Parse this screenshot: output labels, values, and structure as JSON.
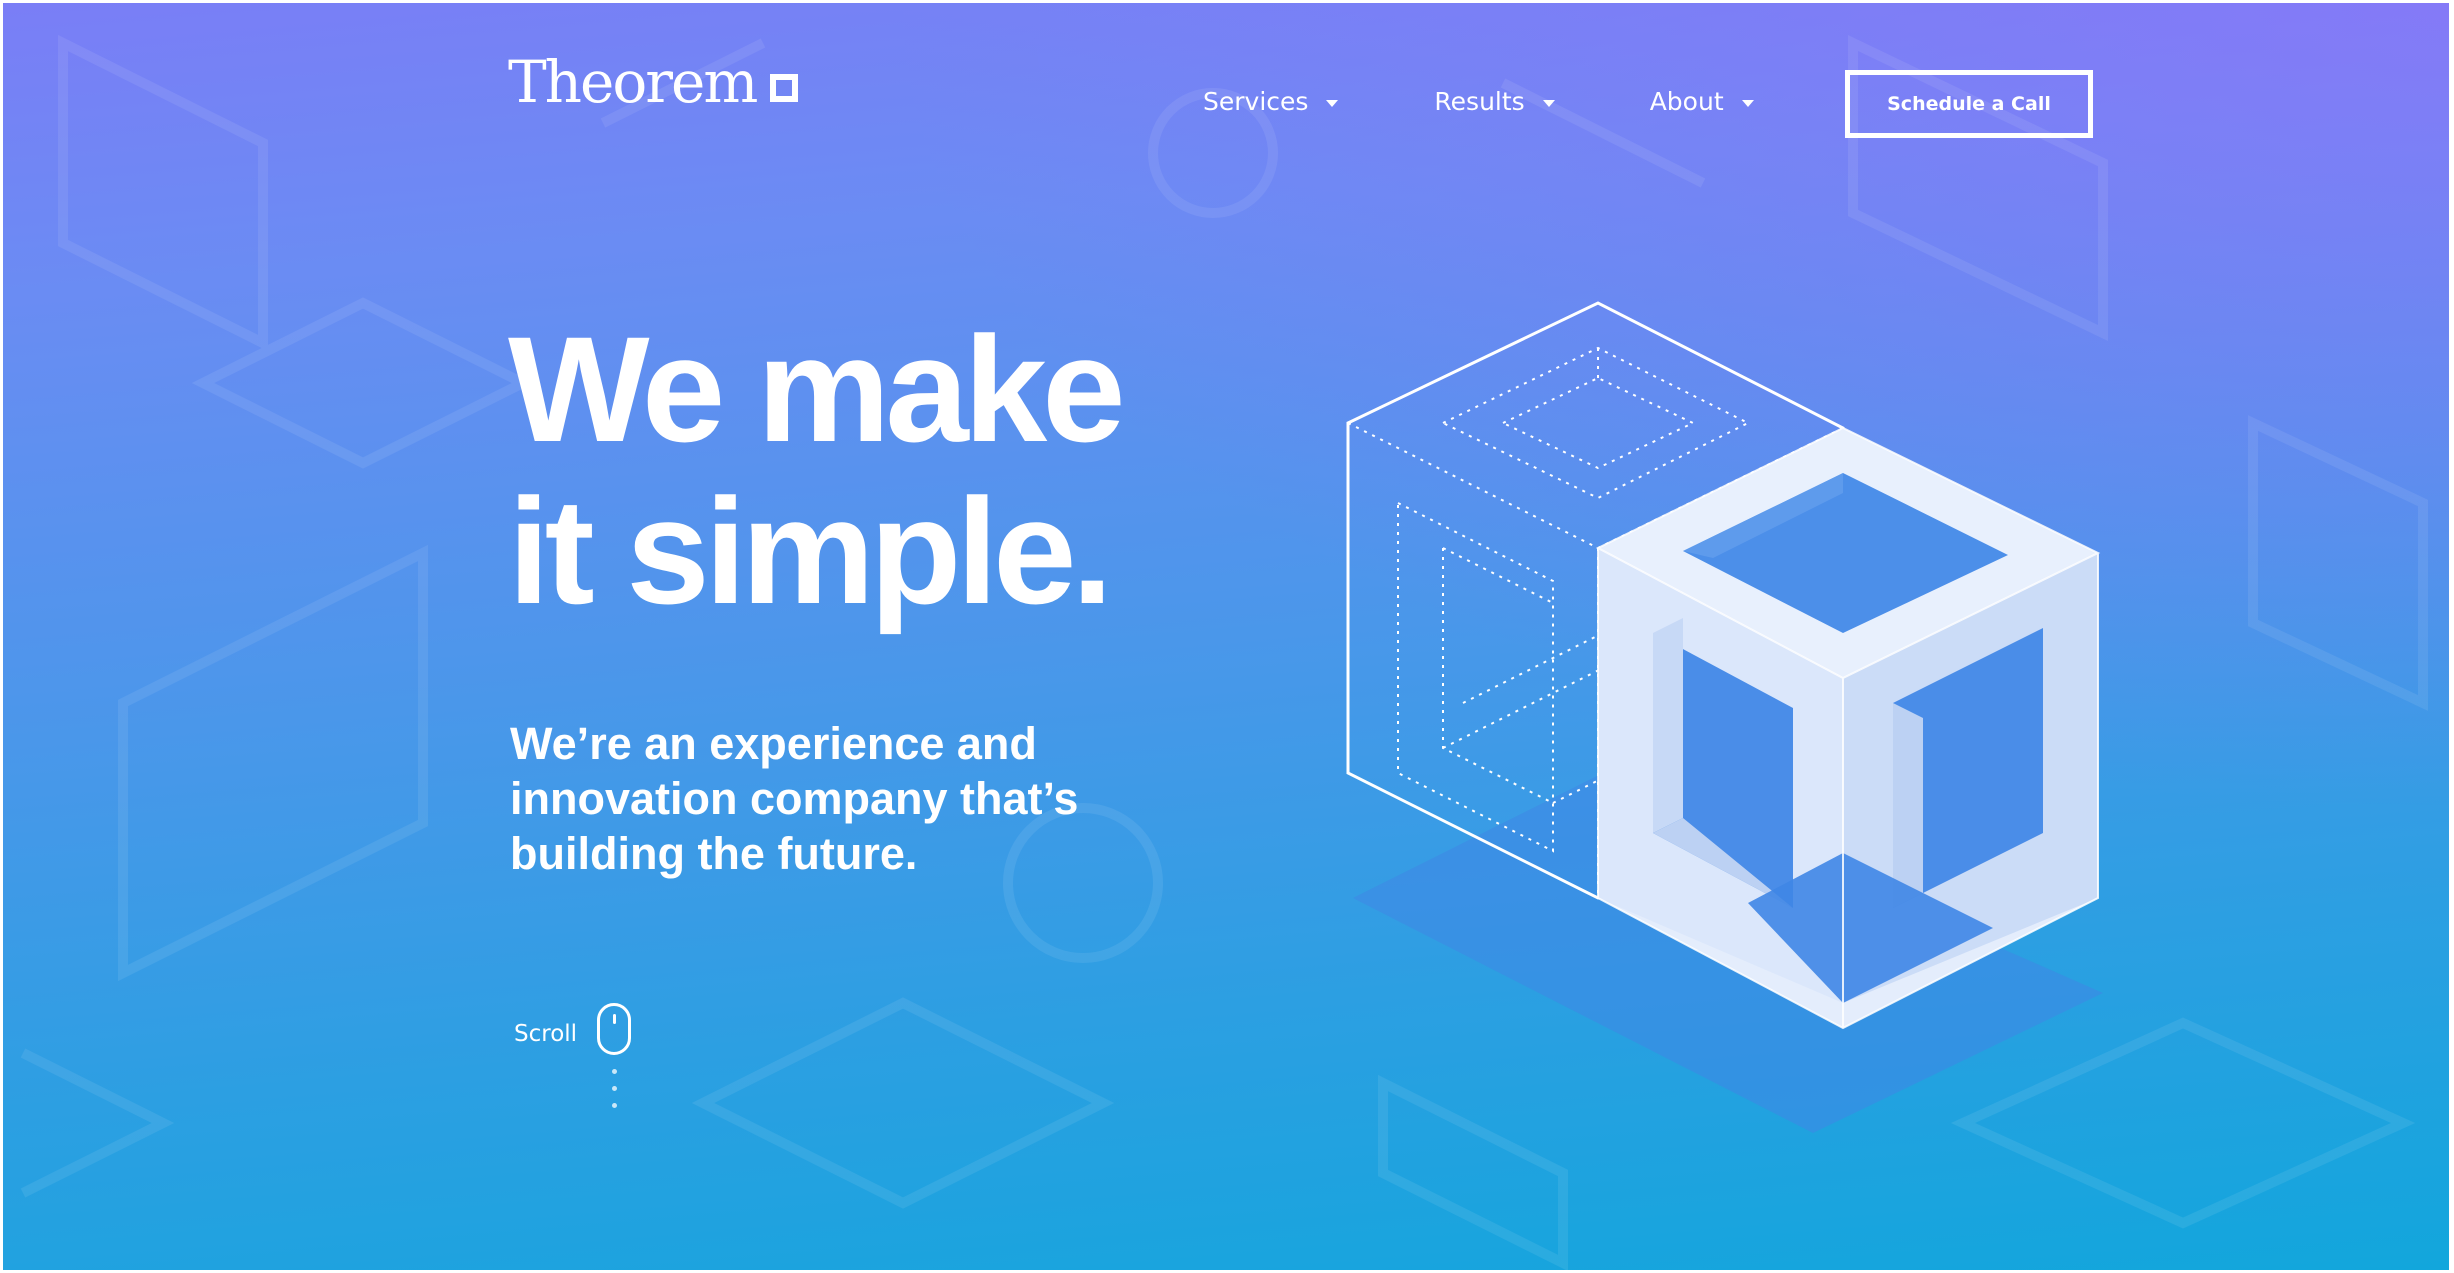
{
  "header": {
    "logo_text": "Theorem",
    "nav": [
      {
        "label": "Services"
      },
      {
        "label": "Results"
      },
      {
        "label": "About"
      }
    ],
    "cta_label": "Schedule a Call"
  },
  "hero": {
    "headline_line1": "We make",
    "headline_line2": "it simple.",
    "subhead": "We’re an experience and innovation company that’s building the future.",
    "scroll_label": "Scroll"
  },
  "icons": {
    "logo_mark": "square-outline-icon",
    "nav_caret": "caret-down-icon",
    "scroll": "mouse-icon",
    "illustration": "impossible-cube-illustration"
  },
  "colors": {
    "gradient_top": "#7a7ef6",
    "gradient_bottom": "#12a6dc",
    "text": "#ffffff",
    "cube_face_light": "#e6effd",
    "cube_face_mid": "#cfdff8",
    "cube_shadow": "#3f86e6"
  }
}
